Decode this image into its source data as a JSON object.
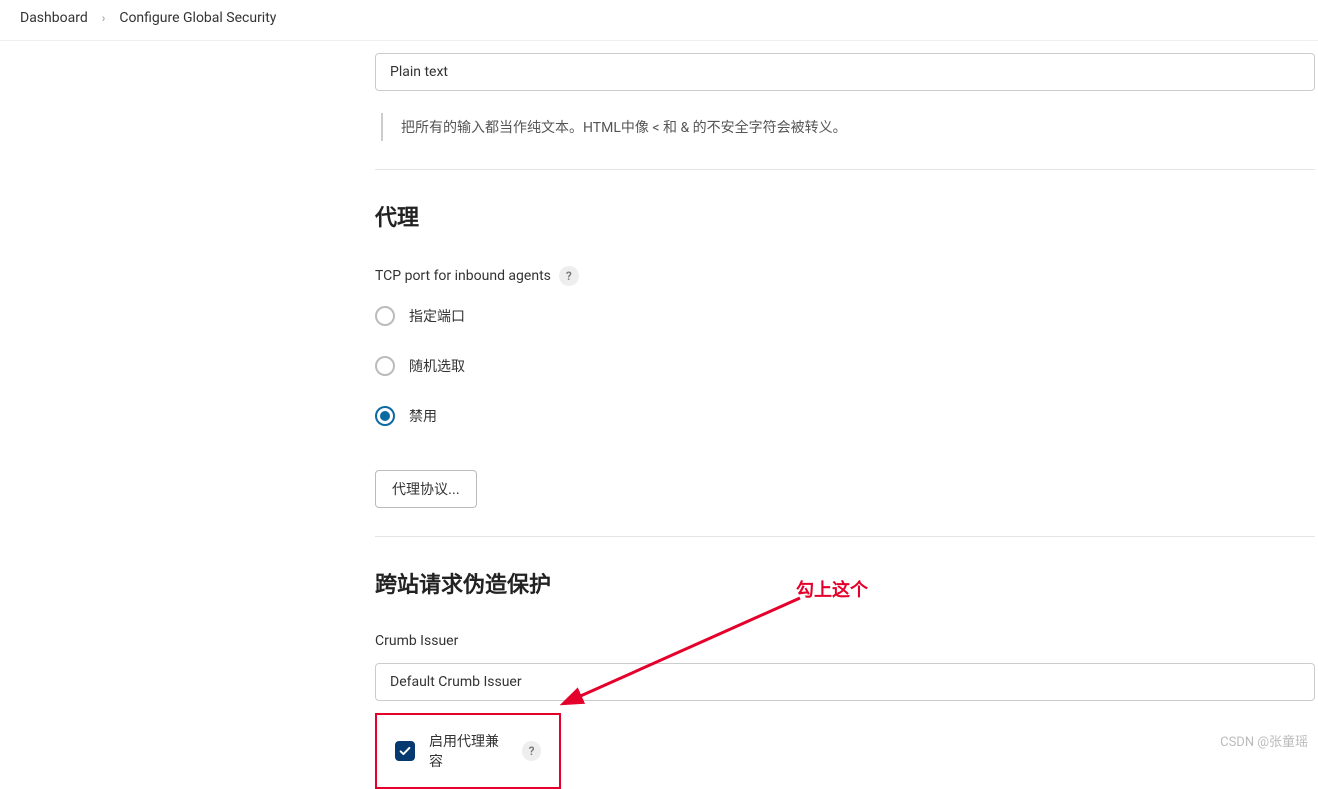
{
  "breadcrumb": {
    "dashboard": "Dashboard",
    "page": "Configure Global Security"
  },
  "markup_formatter": {
    "selected": "Plain text",
    "help_text": "把所有的输入都当作纯文本。HTML中像 < 和 & 的不安全字符会被转义。"
  },
  "agents_section": {
    "title": "代理",
    "tcp_label": "TCP port for inbound agents",
    "options": {
      "fixed": "指定端口",
      "random": "随机选取",
      "disabled": "禁用"
    },
    "protocol_button": "代理协议..."
  },
  "csrf_section": {
    "title": "跨站请求伪造保护",
    "crumb_label": "Crumb Issuer",
    "crumb_selected": "Default Crumb Issuer",
    "proxy_compat_label": "启用代理兼容"
  },
  "annotation": {
    "text": "勾上这个"
  },
  "watermark": "CSDN @张童瑶"
}
